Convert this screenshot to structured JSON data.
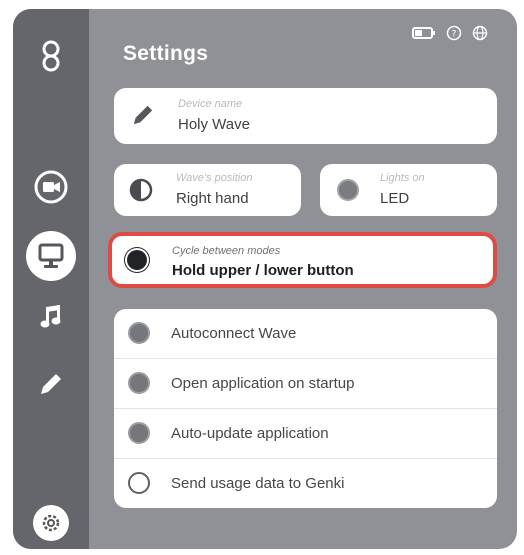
{
  "header": {
    "title": "Settings"
  },
  "topbar": {
    "icons": [
      "battery-icon",
      "help-icon",
      "globe-icon"
    ]
  },
  "sidebar": {
    "items": [
      {
        "name": "logo-icon"
      },
      {
        "name": "camera-icon"
      },
      {
        "name": "monitor-icon",
        "active": true
      },
      {
        "name": "music-icon"
      },
      {
        "name": "pencil-icon"
      },
      {
        "name": "gear-icon"
      }
    ]
  },
  "device": {
    "label": "Device name",
    "value": "Holy Wave"
  },
  "position": {
    "label": "Wave's position",
    "value": "Right hand"
  },
  "lights": {
    "label": "Lights on",
    "value": "LED"
  },
  "cycle": {
    "label": "Cycle between modes",
    "value": "Hold upper / lower button"
  },
  "options": [
    {
      "label": "Autoconnect Wave",
      "checked": true
    },
    {
      "label": "Open application on startup",
      "checked": true
    },
    {
      "label": "Auto-update application",
      "checked": true
    },
    {
      "label": "Send usage data to Genki",
      "checked": false
    }
  ],
  "colors": {
    "window": "#8f9196",
    "sidebar": "#64666b",
    "highlight": "#df4b44"
  }
}
